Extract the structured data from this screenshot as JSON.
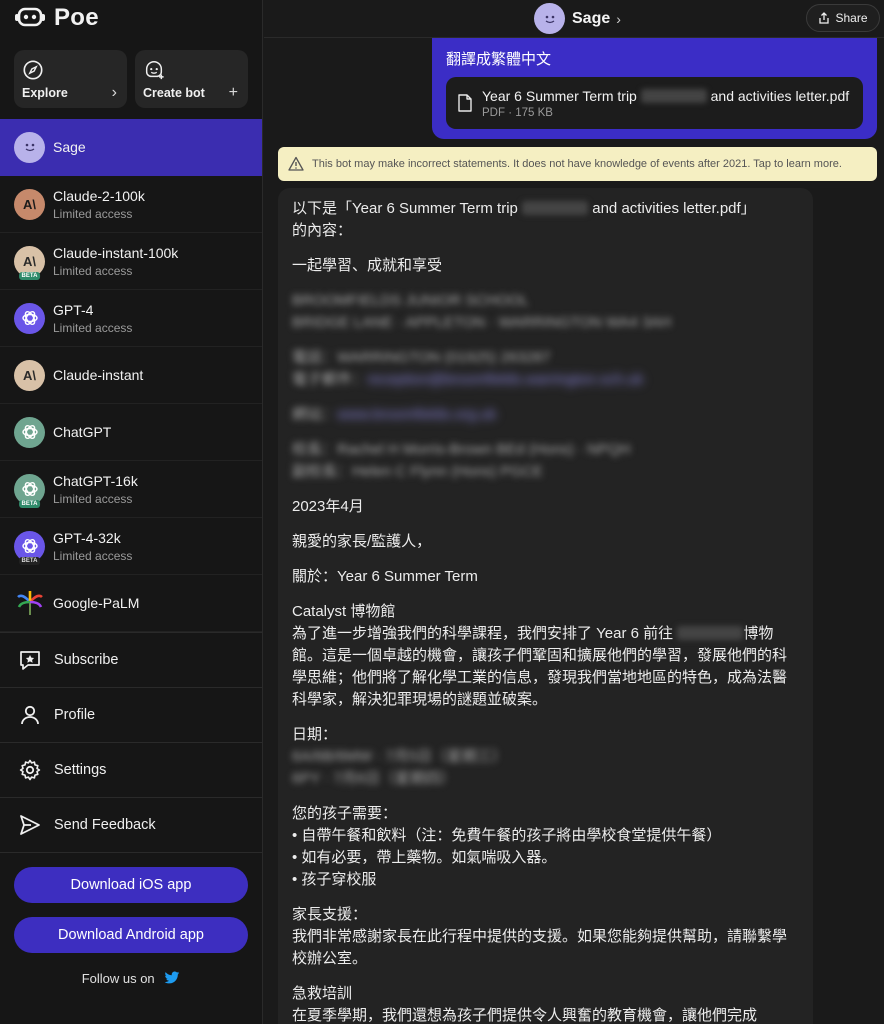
{
  "app": {
    "name": "Poe"
  },
  "sidebar": {
    "explore_label": "Explore",
    "create_label": "Create bot",
    "bots": [
      {
        "name": "Sage",
        "sub": "",
        "active": true,
        "avatar": "sage-face-icon"
      },
      {
        "name": "Claude-2-100k",
        "sub": "Limited access",
        "avatar": "anthropic-logo-icon"
      },
      {
        "name": "Claude-instant-100k",
        "sub": "Limited access",
        "avatar": "anthropic-logo-icon",
        "badge": "BETA"
      },
      {
        "name": "GPT-4",
        "sub": "Limited access",
        "avatar": "openai-logo-icon"
      },
      {
        "name": "Claude-instant",
        "sub": "",
        "avatar": "anthropic-logo-icon"
      },
      {
        "name": "ChatGPT",
        "sub": "",
        "avatar": "openai-logo-icon"
      },
      {
        "name": "ChatGPT-16k",
        "sub": "Limited access",
        "avatar": "openai-logo-icon",
        "badge": "BETA"
      },
      {
        "name": "GPT-4-32k",
        "sub": "Limited access",
        "avatar": "openai-logo-icon",
        "badge": "BETA"
      },
      {
        "name": "Google-PaLM",
        "sub": "",
        "avatar": "palm-logo-icon"
      }
    ],
    "menu": {
      "subscribe": "Subscribe",
      "profile": "Profile",
      "settings": "Settings",
      "feedback": "Send Feedback"
    },
    "download_ios": "Download iOS app",
    "download_android": "Download Android app",
    "follow": "Follow us on"
  },
  "header": {
    "bot_name": "Sage",
    "share_label": "Share"
  },
  "chat": {
    "user_message": "翻譯成繁體中文",
    "file": {
      "name_start": "Year 6 Summer Term trip",
      "name_end": "and activities letter.pdf",
      "meta": "PDF · 175 KB"
    },
    "disclaimer": "This bot may make incorrect statements. It does not have knowledge of events after 2021. Tap to learn more.",
    "reply": {
      "intro_a": "以下是「Year 6 Summer Term trip",
      "intro_b": "and activities letter.pdf」",
      "intro_c": "的內容：",
      "motto": "一起學習、成就和享受",
      "date": "2023年4月",
      "greeting": "親愛的家長/監護人，",
      "re": "關於：Year 6 Summer Term",
      "museum_title": "Catalyst 博物館",
      "museum_body_a": "為了進一步增強我們的科學課程，我們安排了 Year 6 前往",
      "museum_body_b": "博物館。這是一個卓越的機會，讓孩子們鞏固和擴展他們的學習，發展他們的科學思維；他們將了解化學工業的信息，發現我們當地地區的特色，成為法醫科學家，解決犯罪現場的謎題並破案。",
      "date_label": "日期：",
      "needs_title": "您的孩子需要：",
      "needs": [
        "• 自帶午餐和飲料（注：免費午餐的孩子將由學校食堂提供午餐）",
        "• 如有必要，帶上藥物。如氣喘吸入器。",
        "• 孩子穿校服"
      ],
      "support_title": "家長支援：",
      "support_body": "我們非常感謝家長在此行程中提供的支援。如果您能夠提供幫助，請聯繫學校辦公室。",
      "firstaid_title": "急救培訓",
      "firstaid_body": "在夏季學期，我們還想為孩子們提供令人興奮的教育機會，讓他們完成"
    }
  },
  "colors": {
    "accent": "#3b2dc6",
    "sidebar_active": "#3b2db0",
    "disclaimer_bg": "#f5efc2"
  }
}
